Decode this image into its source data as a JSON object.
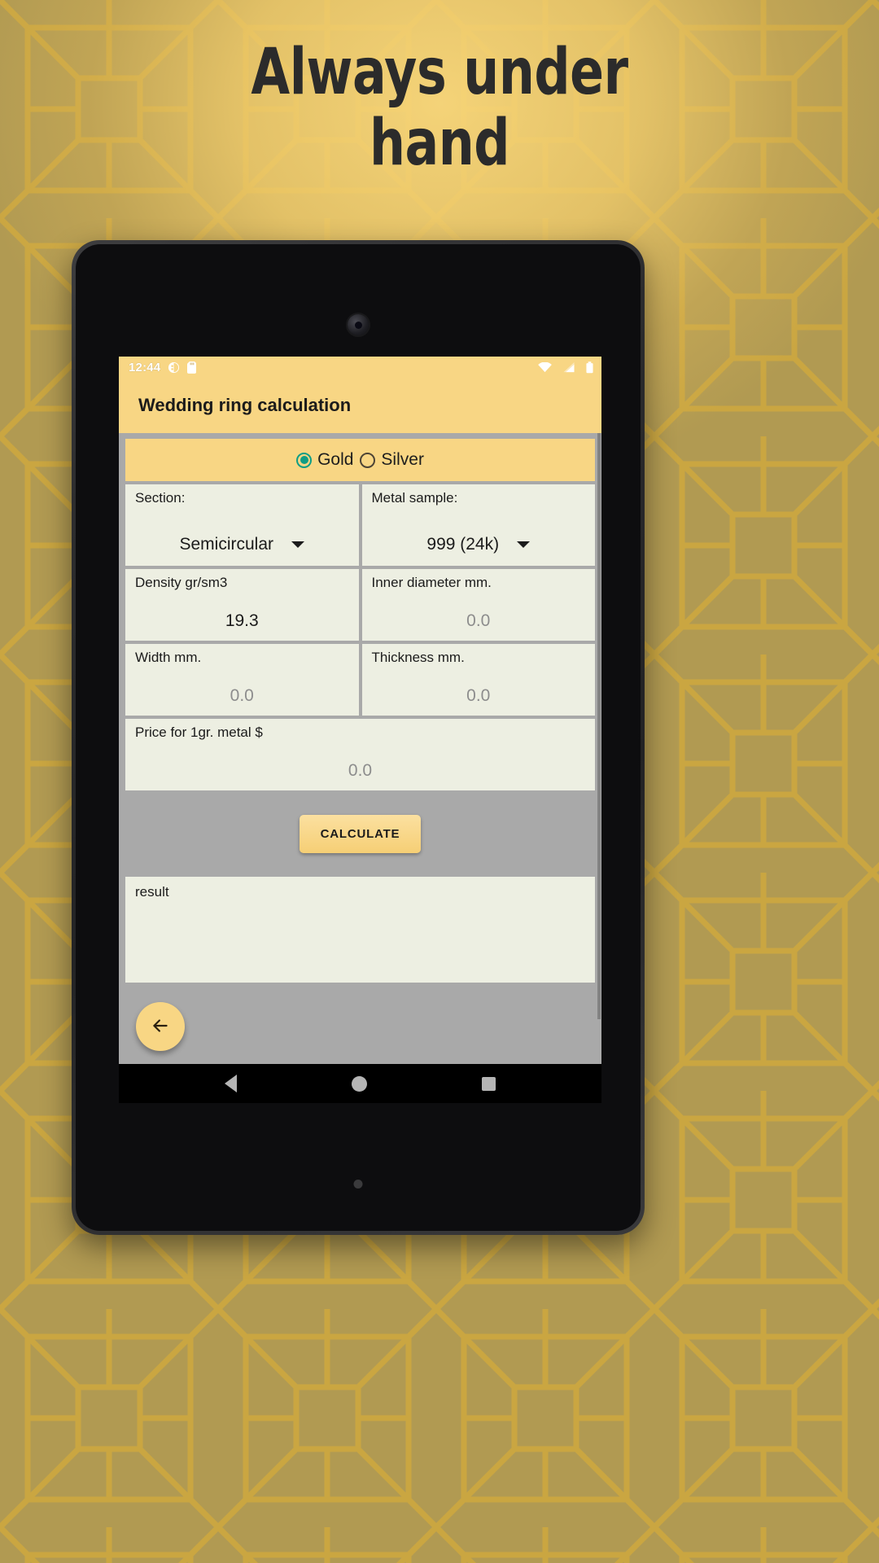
{
  "promo": {
    "headline_line1": "Always under",
    "headline_line2": "hand",
    "background_color": "#b19a52",
    "accent_color": "#f8d684"
  },
  "status_bar": {
    "time": "12:44",
    "icons": [
      "screenshot-icon",
      "sd-card-icon",
      "wifi-icon",
      "signal-icon",
      "battery-icon"
    ]
  },
  "app_bar": {
    "title": "Wedding ring calculation"
  },
  "metal_selector": {
    "options": [
      {
        "label": "Gold",
        "selected": true
      },
      {
        "label": "Silver",
        "selected": false
      }
    ],
    "selected_color": "#0f9d85"
  },
  "fields": {
    "section": {
      "label": "Section:",
      "value": "Semicircular",
      "type": "dropdown"
    },
    "metal_sample": {
      "label": "Metal sample:",
      "value": "999 (24k)",
      "type": "dropdown"
    },
    "density": {
      "label": "Density gr/sm3",
      "value": "19.3",
      "placeholder": "0.0"
    },
    "inner_diameter": {
      "label": "Inner diameter mm.",
      "value": "",
      "placeholder": "0.0"
    },
    "width": {
      "label": "Width mm.",
      "value": "",
      "placeholder": "0.0"
    },
    "thickness": {
      "label": "Thickness mm.",
      "value": "",
      "placeholder": "0.0"
    },
    "price": {
      "label": "Price for 1gr. metal $",
      "value": "",
      "placeholder": "0.0"
    }
  },
  "calculate_button": {
    "label": "CALCULATE"
  },
  "result": {
    "label": "result",
    "value": ""
  },
  "fab": {
    "icon": "arrow-left-icon"
  },
  "nav_bar": {
    "items": [
      "back-icon",
      "home-icon",
      "recents-icon"
    ]
  }
}
